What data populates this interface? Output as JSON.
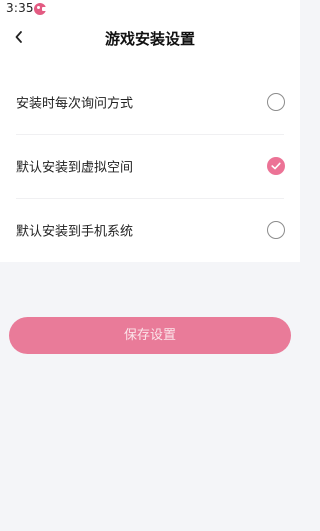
{
  "status_bar": {
    "time": "3:35",
    "app_icon": "pink-pacman-icon"
  },
  "header": {
    "back_icon": "chevron-left-icon",
    "title": "游戏安装设置"
  },
  "options": [
    {
      "label": "安装时每次询问方式",
      "checked": false
    },
    {
      "label": "默认安装到虚拟空间",
      "checked": true
    },
    {
      "label": "默认安装到手机系统",
      "checked": false
    }
  ],
  "save_button": {
    "label": "保存设置"
  },
  "colors": {
    "accent": "#ec7396",
    "button": "#e97b99",
    "background": "#f4f5f8"
  }
}
